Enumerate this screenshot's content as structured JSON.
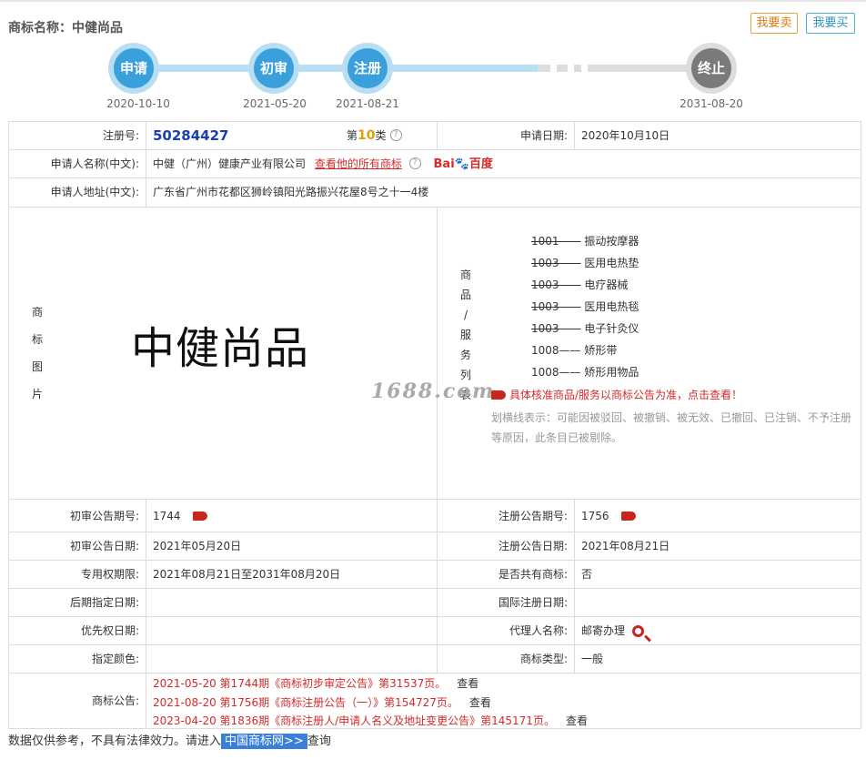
{
  "header": {
    "title": "商标名称：中健尚品",
    "sell_label": "我要卖",
    "buy_label": "我要买"
  },
  "timeline": [
    {
      "label": "申请",
      "date": "2020-10-10"
    },
    {
      "label": "初审",
      "date": "2021-05-20"
    },
    {
      "label": "注册",
      "date": "2021-08-21"
    },
    {
      "label": "终止",
      "date": "2031-08-20"
    }
  ],
  "info": {
    "reg_no_label": "注册号:",
    "reg_no": "50284427",
    "class_prefix": "第",
    "class_num": "10",
    "class_suffix": "类",
    "apply_date_label": "申请日期:",
    "apply_date": "2020年10月10日",
    "applicant_label": "申请人名称(中文):",
    "applicant": "中健（广州）健康产业有限公司",
    "applicant_link": "查看他的所有商标",
    "baidu_label": "Bai",
    "baidu_label2": "百度",
    "address_label": "申请人地址(中文):",
    "address": "广东省广州市花都区狮岭镇阳光路振兴花屋8号之十一4楼",
    "image_label_chars": [
      "商",
      "标",
      "图",
      "片"
    ],
    "mark_text": "中健尚品",
    "goods_label_chars": [
      "商",
      "品",
      "/",
      "服",
      "务",
      "列",
      "表"
    ],
    "goods": [
      {
        "code": "1001",
        "name": "振动按摩器",
        "struck": true
      },
      {
        "code": "1003",
        "name": "医用电热垫",
        "struck": true
      },
      {
        "code": "1003",
        "name": "电疗器械",
        "struck": true
      },
      {
        "code": "1003",
        "name": "医用电热毯",
        "struck": true
      },
      {
        "code": "1003",
        "name": "电子针灸仪",
        "struck": true
      },
      {
        "code": "1008",
        "name": "矫形带",
        "struck": false
      },
      {
        "code": "1008",
        "name": "矫形用物品",
        "struck": false
      }
    ],
    "goods_sep": "——",
    "goods_notice": "具体核准商品/服务以商标公告为准，点击查看！",
    "strike_note": "划横线表示：可能因被驳回、被撤销、被无效、已撤回、已注销、不予注册等原因，此条目已被剔除。",
    "watermark": "1688.com",
    "prelim_no_label": "初审公告期号:",
    "prelim_no": "1744",
    "reg_ann_no_label": "注册公告期号:",
    "reg_ann_no": "1756",
    "prelim_date_label": "初审公告日期:",
    "prelim_date": "2021年05月20日",
    "reg_ann_date_label": "注册公告日期:",
    "reg_ann_date": "2021年08月21日",
    "exclusive_label": "专用权期限:",
    "exclusive": "2021年08月21日至2031年08月20日",
    "shared_label": "是否共有商标:",
    "shared": "否",
    "later_label": "后期指定日期:",
    "intl_label": "国际注册日期:",
    "priority_label": "优先权日期:",
    "agent_label": "代理人名称:",
    "agent": "邮寄办理",
    "color_label": "指定颜色:",
    "type_label": "商标类型:",
    "type": "一般",
    "ann_label": "商标公告:",
    "announcements": [
      "2021-05-20 第1744期《商标初步审定公告》第31537页。",
      "2021-08-20 第1756期《商标注册公告（一）》第154727页。",
      "2023-04-20 第1836期《商标注册人/申请人名义及地址变更公告》第145171页。"
    ],
    "view_label": "查看"
  },
  "footer": {
    "text1": "数据仅供参考，不具有法律效力。请进入",
    "link": "中国商标网>>",
    "text2": "查询"
  },
  "colors": {
    "node_blue": "#3aa0dc",
    "node_ring": "#b8def3",
    "node_gray": "#7a7a7a",
    "red": "#d42a2a"
  }
}
